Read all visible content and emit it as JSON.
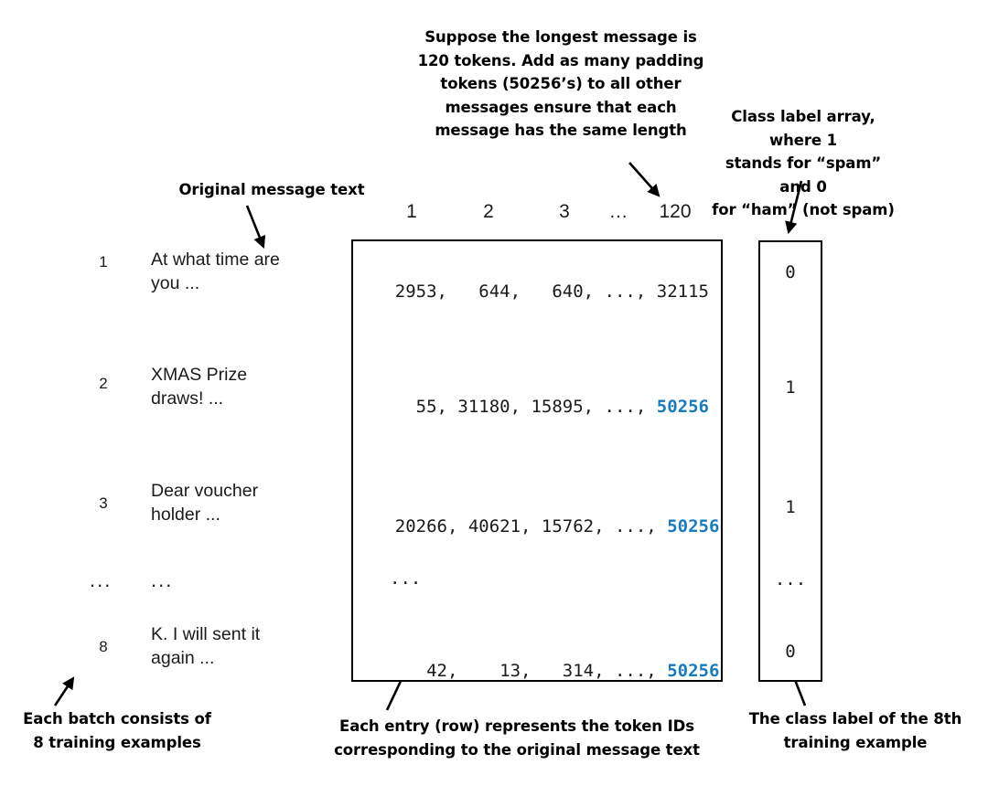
{
  "annotations": {
    "padding_note": "Suppose the longest message is\n120 tokens. Add as many padding\ntokens (50256’s) to all other\nmessages ensure that each\nmessage has the same length",
    "class_label_note": "Class label array, where 1\nstands for “spam” and 0\nfor “ham” (not spam)",
    "original_text_note": "Original message text",
    "batch_note": "Each batch consists of\n8 training examples",
    "entry_note": "Each entry (row) represents the token IDs\ncorresponding to the original message text",
    "class_label_8th_note": "The class label of the 8th\ntraining example"
  },
  "column_headers": [
    "1",
    "2",
    "3",
    "…",
    "120"
  ],
  "rows": [
    {
      "index": "1",
      "message": "At what time are\nyou ...",
      "label": "0"
    },
    {
      "index": "2",
      "message": "XMAS Prize\ndraws!  ...",
      "label": "1"
    },
    {
      "index": "3",
      "message": "Dear voucher\nholder ...",
      "label": "1"
    },
    {
      "index": "...",
      "message": "...",
      "label": "..."
    },
    {
      "index": "8",
      "message": "K. I will sent it\nagain ...",
      "label": "0"
    }
  ],
  "token_matrix": {
    "rows": [
      {
        "prefix": "2953,   644,   640, ..., ",
        "last": "32115",
        "last_is_pad": false
      },
      {
        "prefix": "  55, 31180, 15895, ..., ",
        "last": "50256",
        "last_is_pad": true
      },
      {
        "prefix": "20266, 40621, 15762, ..., ",
        "last": "50256",
        "last_is_pad": true
      },
      {
        "prefix": "...",
        "last": "",
        "last_is_pad": false
      },
      {
        "prefix": "   42,    13,   314, ..., ",
        "last": "50256",
        "last_is_pad": true
      }
    ]
  },
  "colors": {
    "padding_token": "#1a7bb9",
    "text": "#1a1a1a",
    "border": "#000000",
    "background": "#ffffff"
  }
}
